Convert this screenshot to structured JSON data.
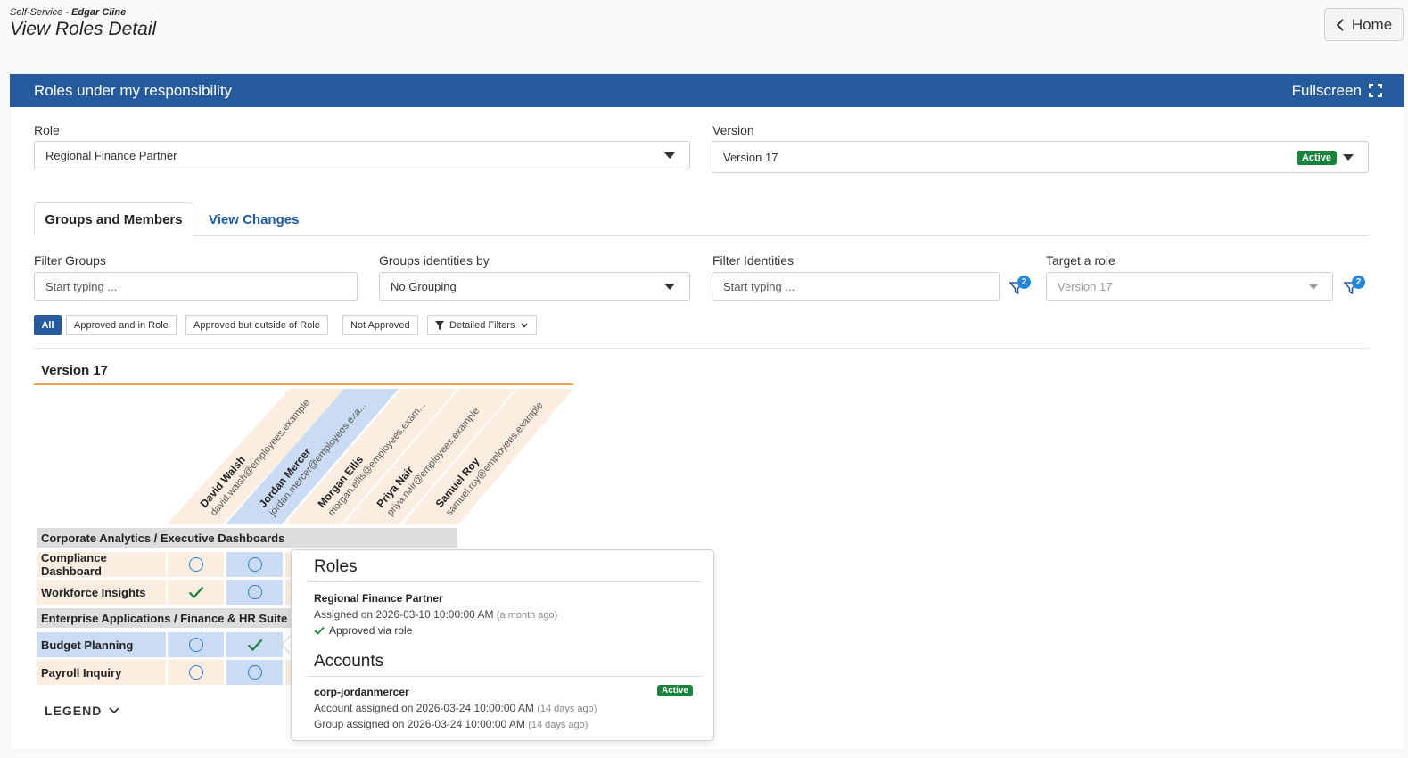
{
  "header": {
    "breadcrumb_prefix": "Self-Service - ",
    "user_name": "Edgar Cline",
    "title": "View Roles Detail",
    "home_label": "Home"
  },
  "panel": {
    "title": "Roles under my responsibility",
    "fullscreen_label": "Fullscreen"
  },
  "role": {
    "label": "Role",
    "value": "Regional Finance Partner"
  },
  "version": {
    "label": "Version",
    "value": "Version 17",
    "status": "Active"
  },
  "tabs": [
    {
      "label": "Groups and Members",
      "active": true
    },
    {
      "label": "View Changes",
      "active": false
    }
  ],
  "filters": {
    "filter_groups": {
      "label": "Filter Groups",
      "placeholder": "Start typing ..."
    },
    "group_by": {
      "label": "Groups identities by",
      "value": "No Grouping"
    },
    "filter_identities": {
      "label": "Filter Identities",
      "placeholder": "Start typing ...",
      "count": "2"
    },
    "target_role": {
      "label": "Target a role",
      "placeholder": "Version 17",
      "count": "2"
    }
  },
  "chips": [
    "All",
    "Approved and in Role",
    "Approved but outside of Role",
    "Not Approved",
    "Detailed Filters"
  ],
  "matrix": {
    "title": "Version 17",
    "identities": [
      {
        "name": "David Walsh",
        "email": "david.walsh@employees.example"
      },
      {
        "name": "Jordan Mercer",
        "email": "jordan.mercer@employees.exa..."
      },
      {
        "name": "Morgan Ellis",
        "email": "morgan.ellis@employees.exam..."
      },
      {
        "name": "Priya Nair",
        "email": "priya.nair@employees.example"
      },
      {
        "name": "Samuel Roy",
        "email": "samuel.roy@employees.example"
      }
    ],
    "groups": [
      {
        "name": "Corporate Analytics / Executive Dashboards",
        "rows": [
          {
            "name": "Compliance Dashboard",
            "cells": [
              "ring",
              "ring"
            ]
          },
          {
            "name": "Workforce Insights",
            "cells": [
              "check",
              "ring"
            ]
          }
        ]
      },
      {
        "name": "Enterprise Applications / Finance & HR Suite",
        "rows": [
          {
            "name": "Budget Planning",
            "cells": [
              "ring",
              "check"
            ]
          },
          {
            "name": "Payroll Inquiry",
            "cells": [
              "ring",
              "ring"
            ]
          }
        ]
      }
    ],
    "legend_label": "LEGEND"
  },
  "popup": {
    "roles_heading": "Roles",
    "role_name": "Regional Finance Partner",
    "role_assigned": "Assigned on 2026-03-10 10:00:00 AM",
    "role_assigned_ago": "(a month ago)",
    "role_status": "Approved via role",
    "accounts_heading": "Accounts",
    "account_name": "corp-jordanmercer",
    "account_status": "Active",
    "account_assigned": "Account assigned on 2026-03-24 10:00:00 AM",
    "account_assigned_ago": "(14 days ago)",
    "group_assigned": "Group assigned on 2026-03-24 10:00:00 AM",
    "group_assigned_ago": "(14 days ago)"
  },
  "colors": {
    "header_blue": "#255a9c",
    "accent_orange": "#f0a040",
    "active_green": "#17833b",
    "identity_peach": "#fbeee0",
    "identity_blue": "#c9dcf3"
  }
}
